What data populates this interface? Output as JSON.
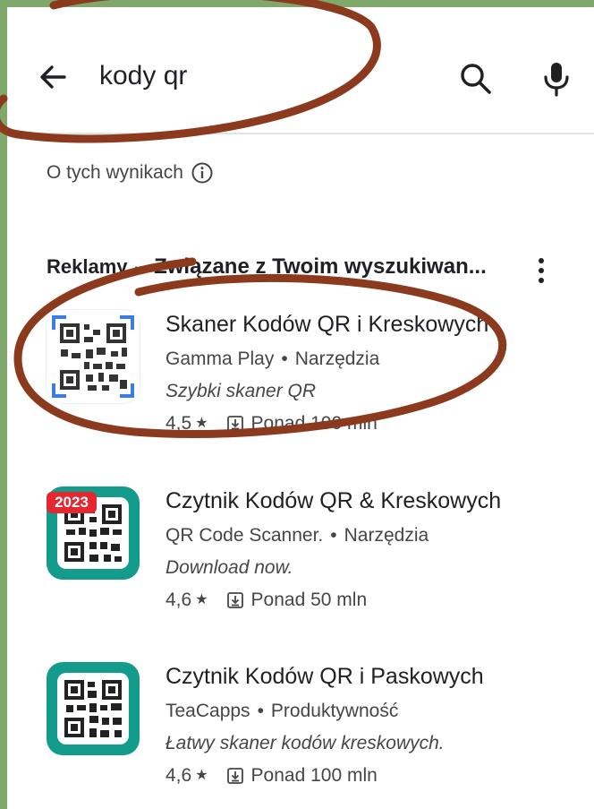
{
  "search": {
    "query": "kody qr",
    "back_icon": "arrow-left-icon",
    "search_icon": "search-icon",
    "mic_icon": "microphone-icon"
  },
  "about": {
    "label": "O tych wynikach",
    "icon": "info-icon"
  },
  "ads": {
    "label": "Reklamy",
    "separator": "·",
    "title": "Związane z Twoim wyszukiwan..."
  },
  "apps": [
    {
      "name": "Skaner Kodów QR i Kreskowych",
      "developer": "Gamma Play",
      "category": "Narzędzia",
      "tagline": "Szybki skaner QR",
      "rating": "4,5",
      "downloads": "Ponad 100 mln"
    },
    {
      "name": "Czytnik Kodów QR & Kreskowych",
      "developer": "QR Code Scanner.",
      "category": "Narzędzia",
      "tagline": "Download now.",
      "rating": "4,6",
      "downloads": "Ponad 50 mln",
      "badge": "2023"
    },
    {
      "name": "Czytnik Kodów QR i Paskowych",
      "developer": "TeaCapps",
      "category": "Produktywność",
      "tagline": "Łatwy skaner kodów kreskowych.",
      "rating": "4,6",
      "downloads": "Ponad 100 mln"
    }
  ],
  "colors": {
    "teal": "#139b8c",
    "badge_red": "#e5272f",
    "annotation": "#8b3a1d",
    "frame_green": "#7fa86a"
  }
}
